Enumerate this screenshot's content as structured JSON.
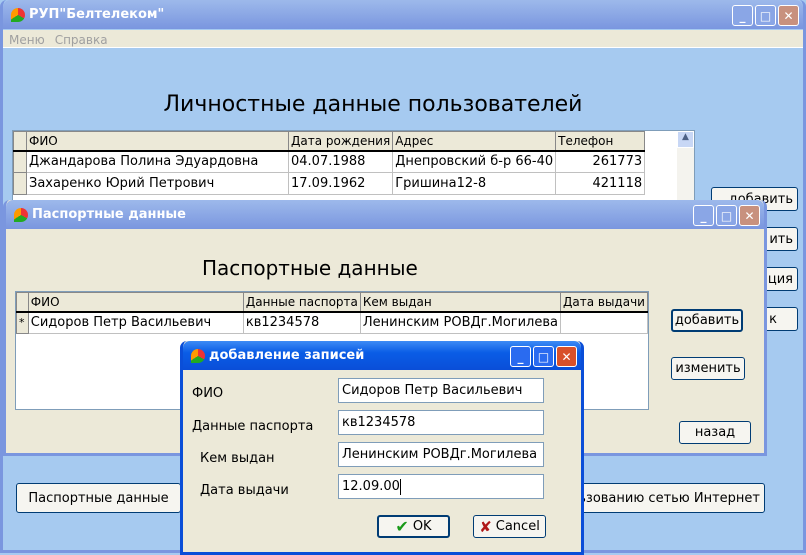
{
  "main": {
    "title": "РУП\"Белтелеком\"",
    "menu": [
      "Меню",
      "Справка"
    ],
    "heading": "Личностные данные пользователей",
    "columns": [
      "ФИО",
      "Дата рождения",
      "Адрес",
      "Телефон"
    ],
    "rows": [
      [
        "Джандарова Полина Эдуардовна",
        "04.07.1988",
        "Днепровский б-р 66-40",
        "261773"
      ],
      [
        "Захаренко Юрий Петрович",
        "17.09.1962",
        "Гришина12-8",
        "421118"
      ]
    ],
    "side_buttons": [
      "добавить",
      "ить",
      "ция",
      "к"
    ],
    "passport_button": "Паспортные данные",
    "internet_button": "льзованию сетью Интернет"
  },
  "passport": {
    "title": "Паспортные данные",
    "heading": "Паспортные данные",
    "columns": [
      "ФИО",
      "Данные паспорта",
      "Кем выдан",
      "Дата выдачи"
    ],
    "rows": [
      {
        "indicator": "*",
        "cells": [
          "Сидоров Петр Васильевич",
          "кв1234578",
          "Ленинским РОВДг.Могилева",
          ""
        ]
      }
    ],
    "add": "добавить",
    "edit": "изменить",
    "back": "назад"
  },
  "dialog": {
    "title": "добавление записей",
    "fields": [
      {
        "label": "ФИО",
        "value": "Сидоров Петр Васильевич"
      },
      {
        "label": "Данные паспорта",
        "value": "кв1234578"
      },
      {
        "label": "Кем выдан",
        "value": "Ленинским РОВДг.Могилева"
      },
      {
        "label": "Дата выдачи",
        "value": "12.09.00"
      }
    ],
    "ok": "OK",
    "cancel": "Cancel"
  }
}
